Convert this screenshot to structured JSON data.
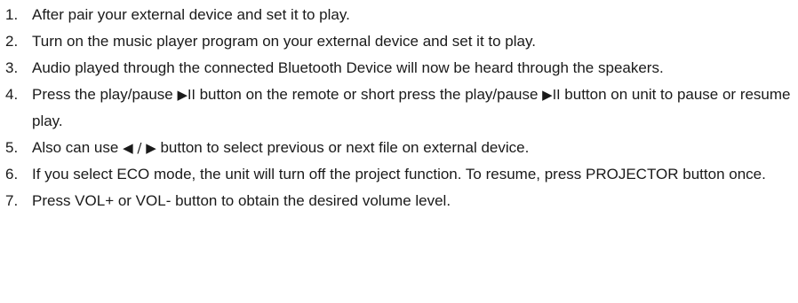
{
  "steps": [
    {
      "number": "1.",
      "text": "After pair your external device and set it to play."
    },
    {
      "number": "2.",
      "text": "Turn on the music player program on your external device and set it to play."
    },
    {
      "number": "3.",
      "text": "Audio played through the connected Bluetooth Device will now be heard through the speakers."
    },
    {
      "number": "4.",
      "text_a": "Press the play/pause ",
      "symbol_a": "▶II",
      "text_b": " button on the remote or short press the play/pause ",
      "symbol_b": "▶II",
      "text_c": " button on unit to pause or resume play."
    },
    {
      "number": "5.",
      "text_a": "Also can use ",
      "symbol_a": "◀ / ▶",
      "text_b": " button to select previous or next file on external device."
    },
    {
      "number": "6.",
      "text": "If you select ECO mode, the unit will turn off the project function. To resume, press PROJECTOR button once."
    },
    {
      "number": "7.",
      "text": "Press VOL+ or VOL- button to obtain the desired volume level."
    }
  ]
}
